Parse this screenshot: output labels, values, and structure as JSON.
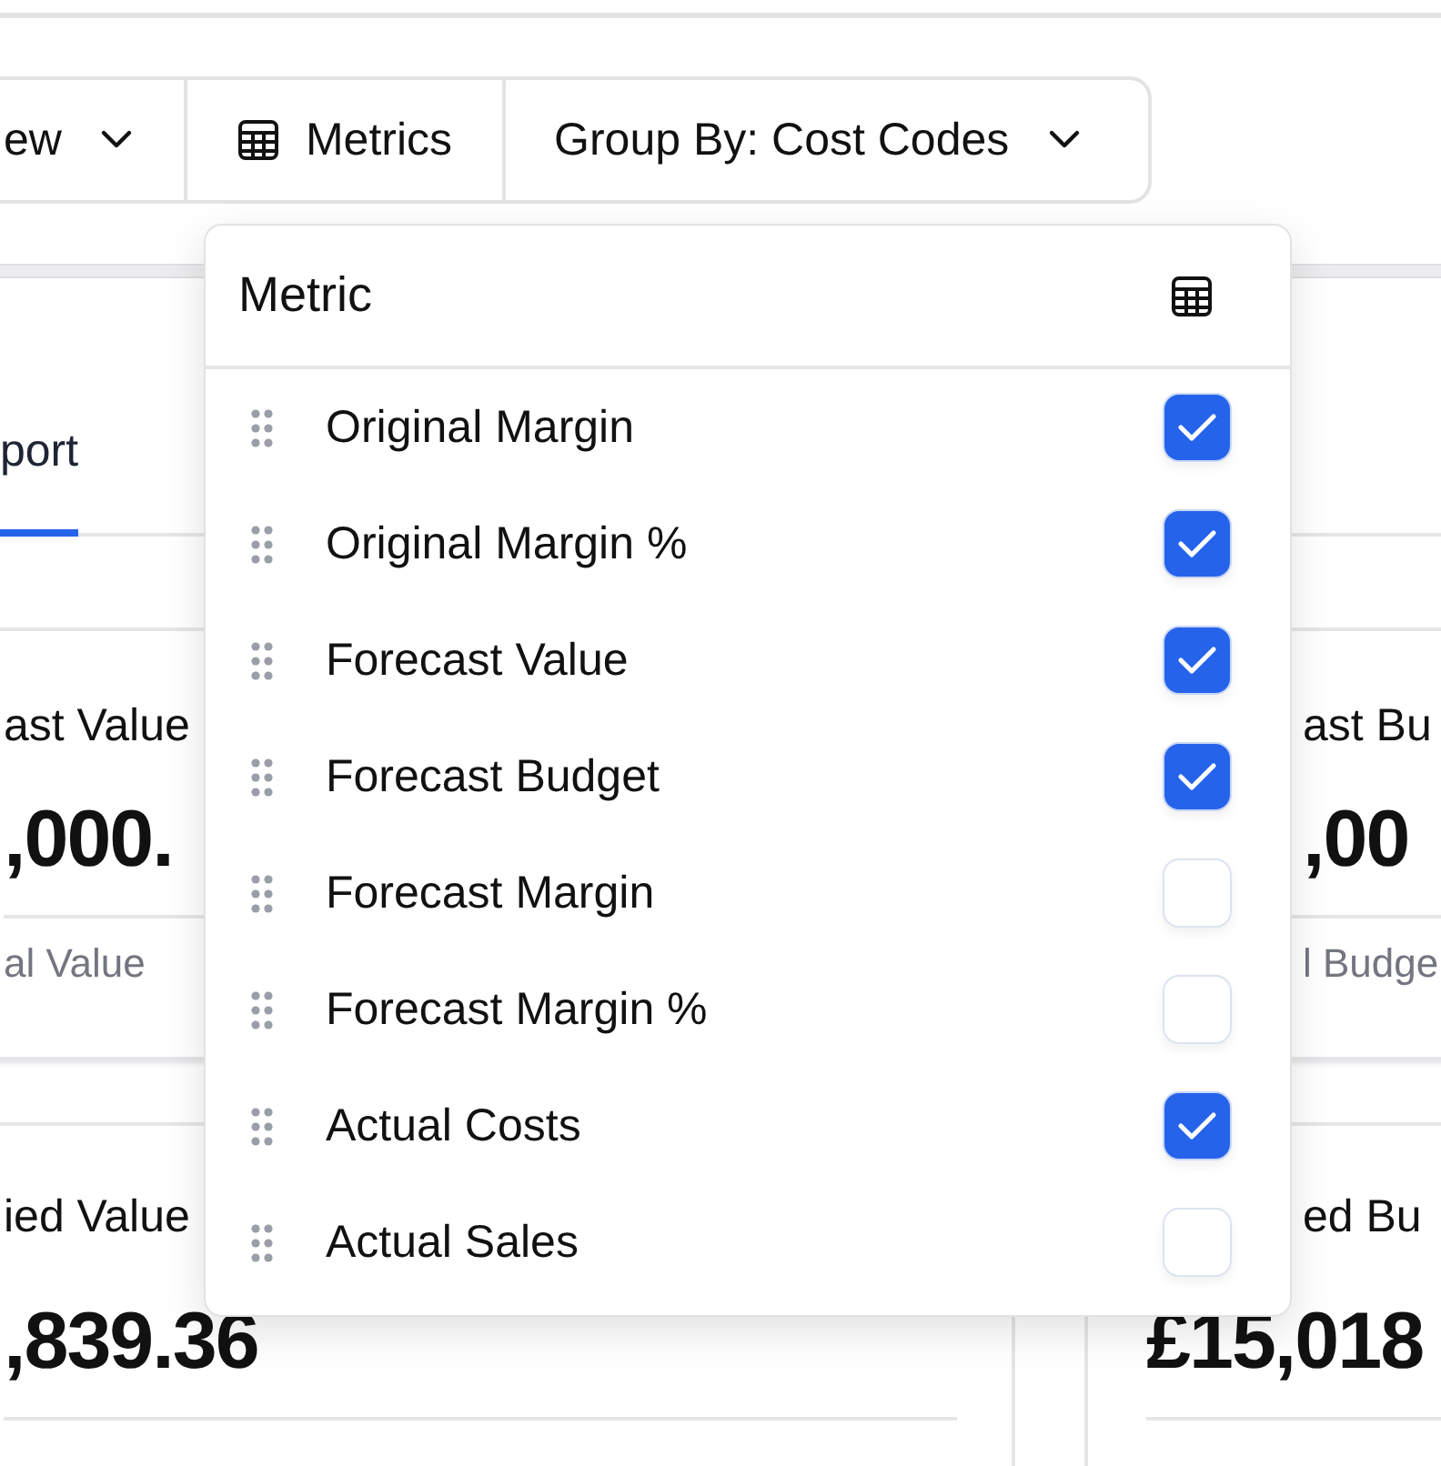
{
  "toolbar": [
    {
      "kind": "dropdown",
      "label": "ew"
    },
    {
      "kind": "table",
      "label": "Metrics"
    },
    {
      "kind": "dropdown",
      "label": "Group By: Cost Codes"
    }
  ],
  "tabs": [
    {
      "label": "port",
      "selected": true
    }
  ],
  "cards": [
    {
      "title": "ast Value",
      "value": ",000.",
      "caption": "al Value"
    },
    {
      "title": "ast Bu",
      "value": ",00",
      "caption": "l Budge"
    },
    {
      "title": "ied Value",
      "value": ",839.36"
    },
    {
      "title": "ed Bu",
      "value": "£15,018"
    }
  ],
  "metrics_menu": {
    "title": "Metric",
    "items": [
      {
        "label": "Original Margin",
        "checked": true
      },
      {
        "label": "Original Margin %",
        "checked": true
      },
      {
        "label": "Forecast Value",
        "checked": true
      },
      {
        "label": "Forecast Budget",
        "checked": true
      },
      {
        "label": "Forecast Margin",
        "checked": false
      },
      {
        "label": "Forecast Margin %",
        "checked": false
      },
      {
        "label": "Actual Costs",
        "checked": true
      },
      {
        "label": "Actual Sales",
        "checked": false
      }
    ]
  }
}
